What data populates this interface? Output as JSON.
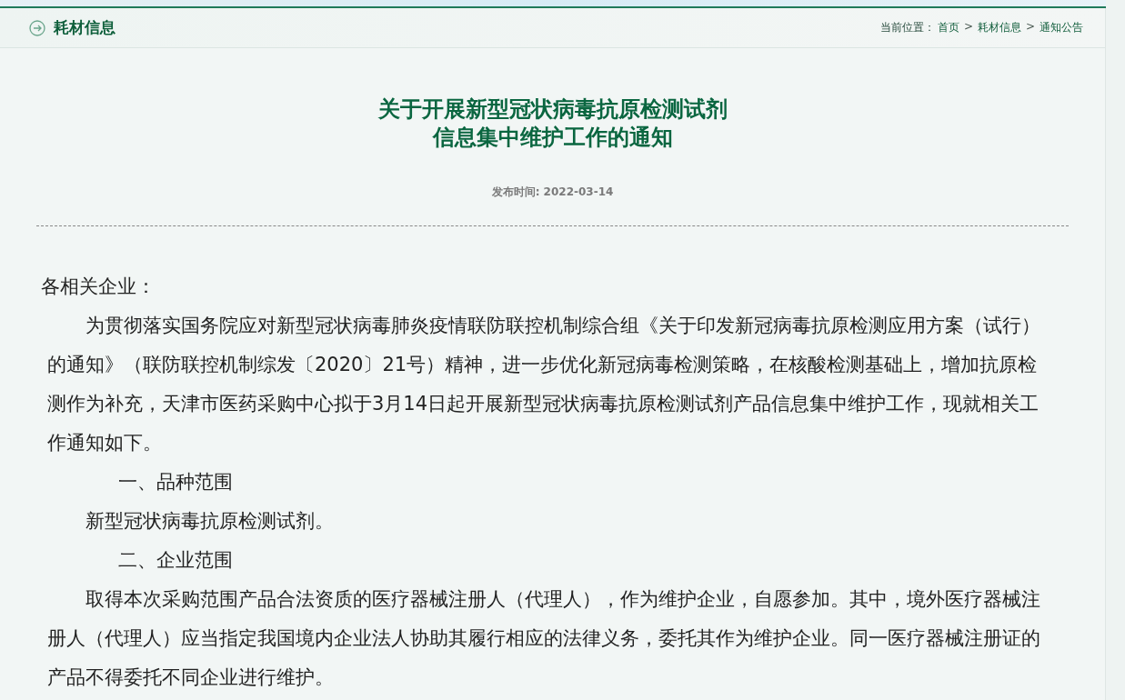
{
  "header": {
    "title": "耗材信息",
    "breadcrumb": [
      {
        "kind": "label",
        "text": "当前位置："
      },
      {
        "kind": "link",
        "text": "首页"
      },
      {
        "kind": "separator",
        "text": ">"
      },
      {
        "kind": "link",
        "text": "耗材信息"
      },
      {
        "kind": "separator",
        "text": ">"
      },
      {
        "kind": "link",
        "text": "通知公告"
      }
    ]
  },
  "article": {
    "title_lines": [
      "关于开展新型冠状病毒抗原检测试剂",
      "信息集中维护工作的通知"
    ],
    "date": "发布时间: 2022-03-14",
    "paragraphs": [
      {
        "kind": "salutation",
        "text": "各相关企业："
      },
      {
        "kind": "body",
        "text": "为贯彻落实国务院应对新型冠状病毒肺炎疫情联防联控机制综合组《关于印发新冠病毒抗原检测应用方案（试行）的通知》（联防联控机制综发〔2020〕21号）精神，进一步优化新冠病毒检测策略，在核酸检测基础上，增加抗原检测作为补充，天津市医药采购中心拟于3月14日起开展新型冠状病毒抗原检测试剂产品信息集中维护工作，现就相关工作通知如下。"
      },
      {
        "kind": "heading",
        "text": "一、品种范围"
      },
      {
        "kind": "body",
        "text": "新型冠状病毒抗原检测试剂。"
      },
      {
        "kind": "heading",
        "text": "二、企业范围"
      },
      {
        "kind": "body",
        "text": "取得本次采购范围产品合法资质的医疗器械注册人（代理人），作为维护企业，自愿参加。其中，境外医疗器械注册人（代理人）应当指定我国境内企业法人协助其履行相应的法律义务，委托其作为维护企业。同一医疗器械注册证的产品不得委托不同企业进行维护。"
      }
    ]
  }
}
